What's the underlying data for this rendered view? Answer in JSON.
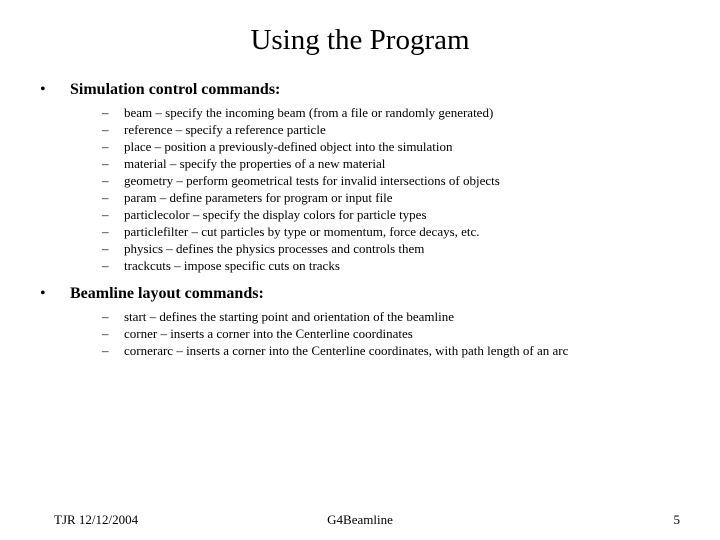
{
  "title": "Using the Program",
  "sections": [
    {
      "heading": "Simulation control commands:",
      "items": [
        "beam – specify the incoming beam (from a file or randomly generated)",
        "reference – specify a reference particle",
        "place – position a previously-defined object into the simulation",
        "material – specify the properties of a new material",
        "geometry – perform geometrical tests for invalid intersections of objects",
        "param – define parameters for program or input file",
        "particlecolor – specify the display colors for particle types",
        "particlefilter – cut particles by type or momentum, force decays, etc.",
        "physics – defines the physics processes and controls them",
        "trackcuts – impose specific cuts on tracks"
      ]
    },
    {
      "heading": "Beamline layout commands:",
      "items": [
        "start – defines the starting point and orientation of the beamline",
        "corner – inserts a corner into the Centerline coordinates",
        "cornerarc – inserts a corner into the Centerline coordinates, with path length of an arc"
      ]
    }
  ],
  "footer": {
    "left": "TJR  12/12/2004",
    "center": "G4Beamline",
    "right": "5"
  }
}
